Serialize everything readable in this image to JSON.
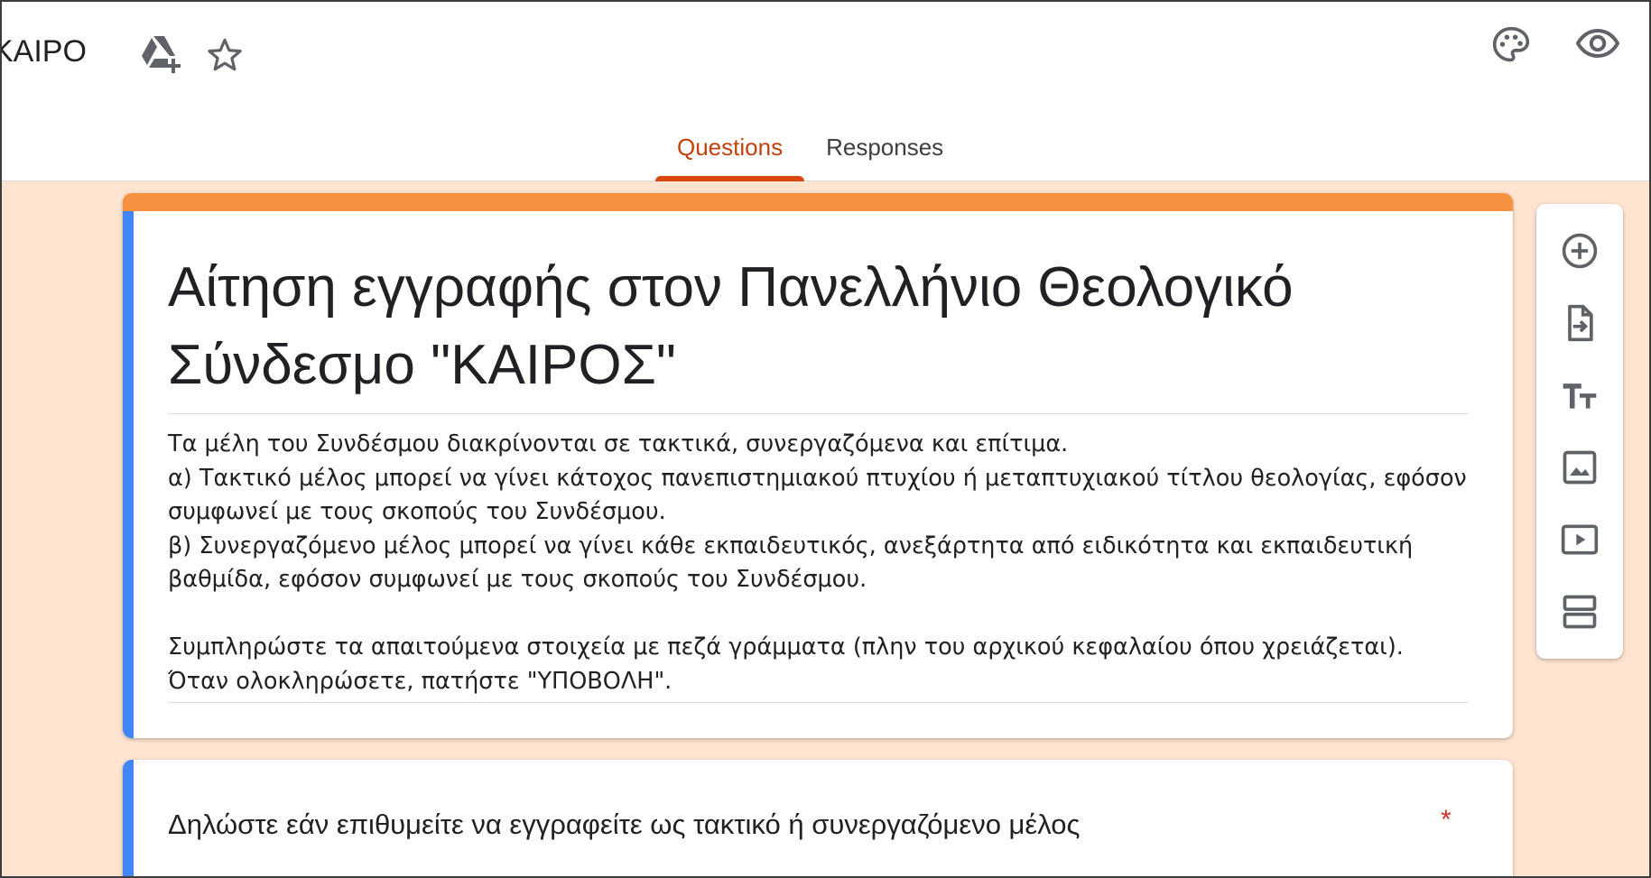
{
  "header": {
    "doc_title": "KAIPO",
    "tabs": [
      {
        "label": "Questions",
        "active": true
      },
      {
        "label": "Responses",
        "active": false
      }
    ],
    "icons": [
      "drive-add-icon",
      "star-icon",
      "palette-icon",
      "eye-icon"
    ]
  },
  "form": {
    "title": "Αίτηση εγγραφής στον Πανελλήνιο Θεολογικό Σύνδεσμο \"ΚΑΙΡΟΣ\"",
    "description": "Τα μέλη του Συνδέσμου διακρίνονται σε τακτικά, συνεργαζόμενα και επίτιμα.\nα) Τακτικό μέλος μπορεί να γίνει κάτοχος πανεπιστημιακού πτυχίου ή μεταπτυχιακού τίτλου θεολογίας, εφόσον συμφωνεί με τους σκοπούς του Συνδέσμου.\nβ) Συνεργαζόμενο μέλος μπορεί να γίνει κάθε εκπαιδευτικός, ανεξάρτητα από ειδικότητα και εκπαιδευτική βαθμίδα, εφόσον συμφωνεί με τους σκοπούς του Συνδέσμου.\n\nΣυμπληρώστε τα απαιτούμενα στοιχεία με πεζά γράμματα (πλην του αρχικού κεφαλαίου όπου χρειάζεται).\nΌταν ολοκληρώσετε, πατήστε \"ΥΠΟΒΟΛΗ\"."
  },
  "question": {
    "title": "Δηλώστε εάν επιθυμείτε να εγγραφείτε ως τακτικό ή συνεργαζόμενο μέλος",
    "required_mark": "*"
  },
  "toolbar": {
    "items": [
      "add-question-icon",
      "import-questions-icon",
      "add-title-icon",
      "add-image-icon",
      "add-video-icon",
      "add-section-icon"
    ]
  },
  "colors": {
    "accent": "#f6923f",
    "tab_active": "#d9480f",
    "card_left_bar": "#4285f4",
    "background": "#ffe5d1",
    "required": "#d93025"
  }
}
